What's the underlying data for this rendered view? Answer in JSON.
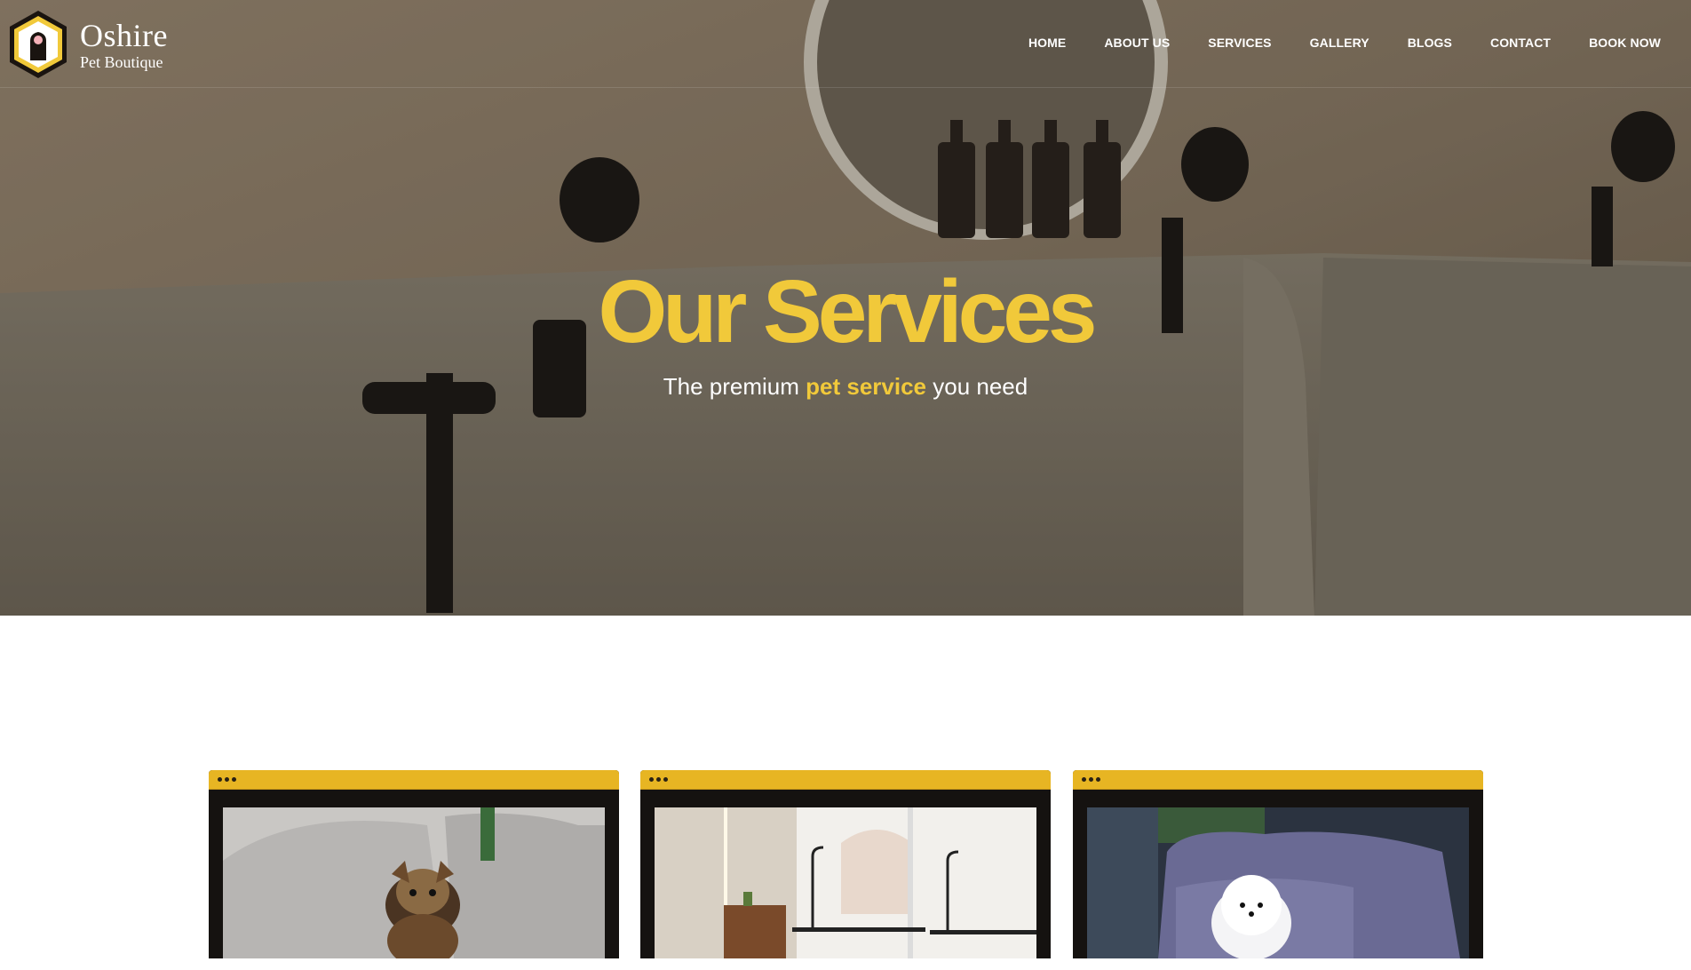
{
  "brand": {
    "name": "Oshire",
    "subtitle": "Pet Boutique"
  },
  "nav": [
    "HOME",
    "ABOUT US",
    "SERVICES",
    "GALLERY",
    "BLOGS",
    "CONTACT",
    "BOOK NOW"
  ],
  "hero": {
    "title": "Our Services",
    "subtitle_before": "The premium ",
    "subtitle_highlight": "pet service",
    "subtitle_after": " you need"
  },
  "colors": {
    "accent": "#f1c93a",
    "card_bar": "#e7b523",
    "card_frame": "#151210"
  },
  "cards": [
    {
      "image": "yorkie-puppy-on-sofa"
    },
    {
      "image": "grooming-salon-interior"
    },
    {
      "image": "white-pomeranian-on-sofa"
    }
  ]
}
